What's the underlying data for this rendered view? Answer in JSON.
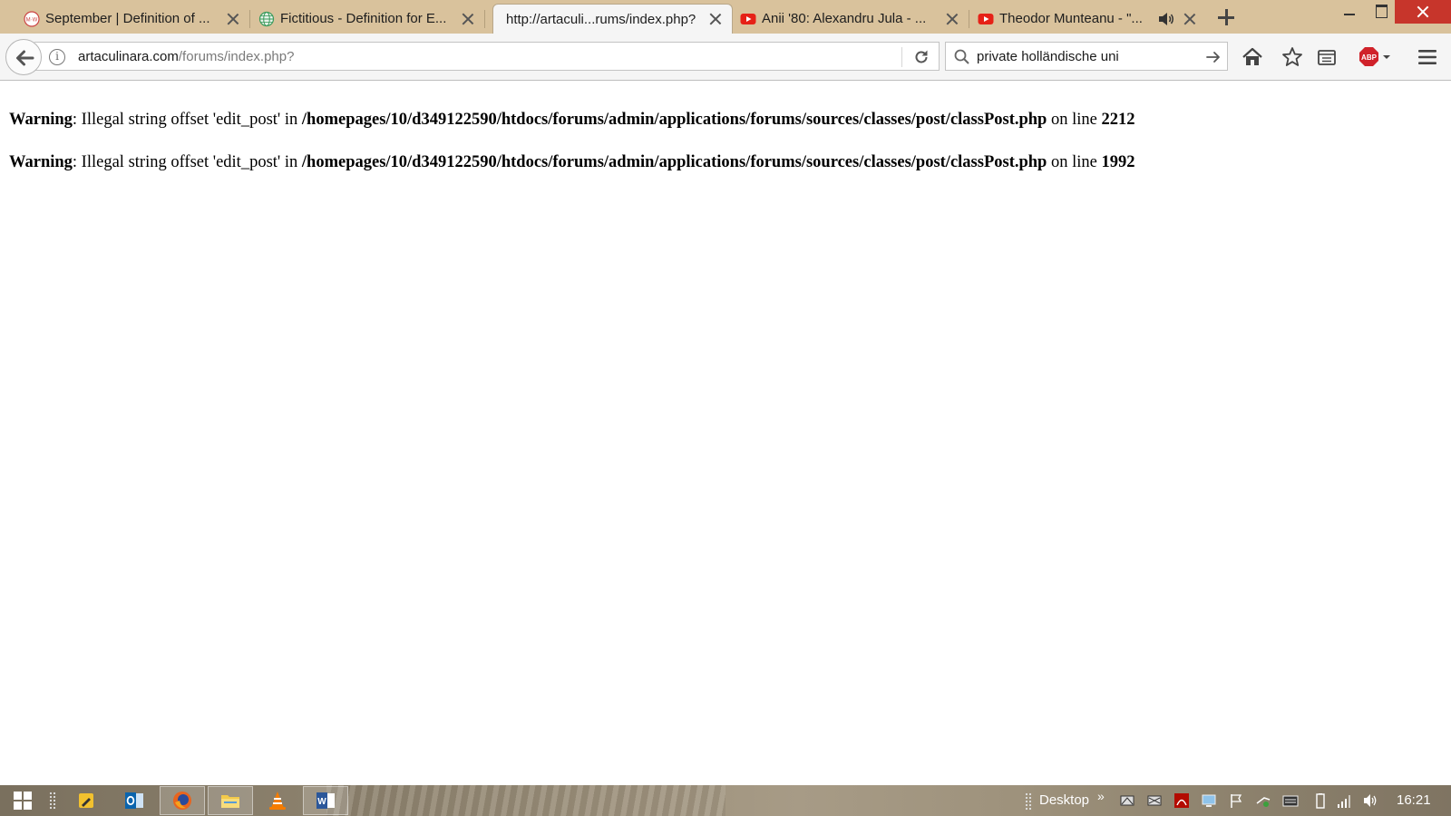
{
  "tabs": [
    {
      "title": "September | Definition of ...",
      "favicon": "merriam-webster-icon",
      "active": false
    },
    {
      "title": "Fictitious - Definition for E...",
      "favicon": "globe-icon",
      "active": false
    },
    {
      "title": "http://artaculi...rums/index.php?",
      "favicon": "",
      "active": true
    },
    {
      "title": "Anii '80: Alexandru Jula - ...",
      "favicon": "youtube-icon",
      "active": false
    },
    {
      "title": "Theodor Munteanu - \"...",
      "favicon": "youtube-icon",
      "active": false,
      "audio": true
    }
  ],
  "navbar": {
    "url_domain": "artaculinara.com",
    "url_path": "/forums/index.php?",
    "search_value": "private holländische uni"
  },
  "page": {
    "warnings": [
      {
        "label": "Warning",
        "message": ": Illegal string offset 'edit_post' in ",
        "path": "/homepages/10/d349122590/htdocs/forums/admin/applications/forums/sources/classes/post/classPost.php",
        "on_line": " on line ",
        "line": "2212"
      },
      {
        "label": "Warning",
        "message": ": Illegal string offset 'edit_post' in ",
        "path": "/homepages/10/d349122590/htdocs/forums/admin/applications/forums/sources/classes/post/classPost.php",
        "on_line": " on line ",
        "line": "1992"
      }
    ]
  },
  "taskbar": {
    "apps": [
      "outlook-icon",
      "firefox-icon",
      "file-explorer-icon",
      "vlc-icon",
      "word-icon"
    ],
    "desktop_label": "Desktop",
    "clock": "16:21"
  },
  "colors": {
    "tabstrip": "#d9c29c",
    "close_button": "#c7352b",
    "youtube": "#e62117",
    "abp": "#d0222a"
  }
}
